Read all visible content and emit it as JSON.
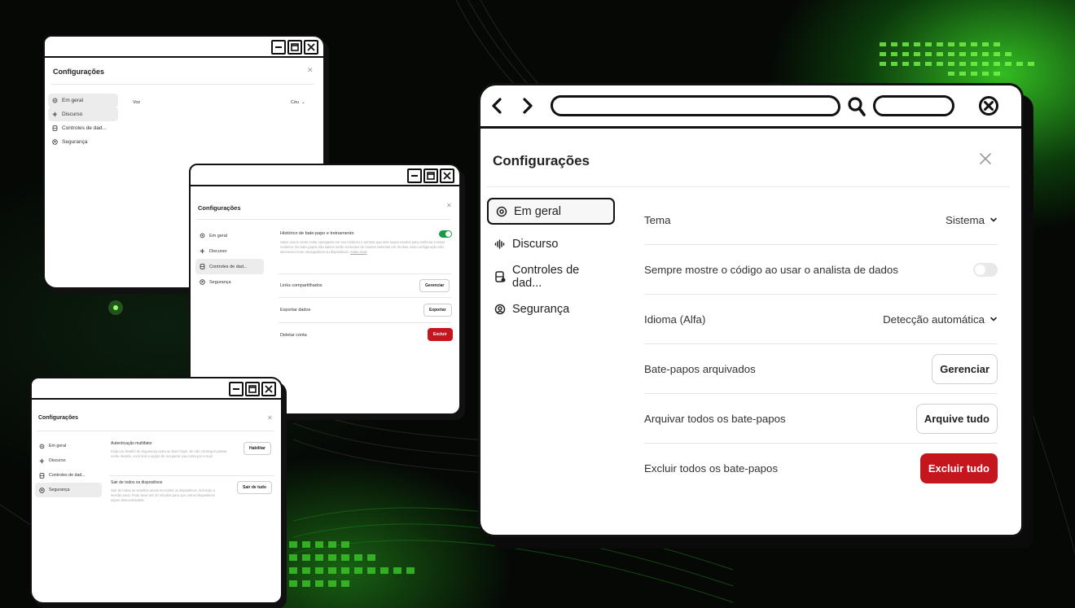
{
  "colors": {
    "accent_green": "#3cdc28",
    "danger_red": "#c4161c",
    "toggle_on": "#1a9b4b"
  },
  "window_general": {
    "title": "Configurações",
    "nav": [
      {
        "label": "Em geral",
        "icon": "gear-icon"
      },
      {
        "label": "Discurso",
        "icon": "waveform-icon"
      },
      {
        "label": "Controles de dad...",
        "icon": "database-icon"
      },
      {
        "label": "Segurança",
        "icon": "shield-icon"
      }
    ],
    "voice_label": "Voz",
    "voice_value": "Céu"
  },
  "window_data": {
    "title": "Configurações",
    "nav": [
      {
        "label": "Em geral",
        "icon": "gear-icon"
      },
      {
        "label": "Discurso",
        "icon": "waveform-icon"
      },
      {
        "label": "Controles de dad...",
        "icon": "database-icon"
      },
      {
        "label": "Segurança",
        "icon": "shield-icon"
      }
    ],
    "history_title": "Histórico de bate-papo e treinamento",
    "history_desc": "Salve novos chats neste navegador em seu histórico e permita que eles sejam usados para melhorar nossos modelos. Os bate-papos não salvos serão excluídos de nossos sistemas em 30 dias. Esta configuração não sincroniza entre navegadores ou dispositivos.",
    "history_link": "Saiba mais",
    "rows": [
      {
        "label": "Links compartilhados",
        "button": "Gerenciar"
      },
      {
        "label": "Exportar dados",
        "button": "Exportar"
      },
      {
        "label": "Deletar conta",
        "button": "Excluir"
      }
    ]
  },
  "window_security": {
    "title": "Configurações",
    "nav": [
      {
        "label": "Em geral",
        "icon": "gear-icon"
      },
      {
        "label": "Discurso",
        "icon": "waveform-icon"
      },
      {
        "label": "Controles de dad...",
        "icon": "database-icon"
      },
      {
        "label": "Segurança",
        "icon": "shield-icon"
      }
    ],
    "mfa_title": "Autenticação multifator",
    "mfa_desc": "Exija um desafio de segurança extra ao fazer login. Se não conseguir passar neste desafio, você terá a opção de recuperar sua conta por e-mail.",
    "mfa_button": "Habilitar",
    "logout_title": "Sair de todos os dispositivos",
    "logout_desc": "Sair de todas as sessões ativas em todos os dispositivos, incluindo a sessão atual. Pode levar até 30 minutos para que outros dispositivos sejam desconectados.",
    "logout_button": "Sair de tudo"
  },
  "main": {
    "title": "Configurações",
    "nav": [
      {
        "label": "Em geral",
        "icon": "gear-icon"
      },
      {
        "label": "Discurso",
        "icon": "waveform-icon"
      },
      {
        "label": "Controles de dad...",
        "icon": "database-icon"
      },
      {
        "label": "Segurança",
        "icon": "shield-icon"
      }
    ],
    "rows": {
      "theme_label": "Tema",
      "theme_value": "Sistema",
      "code_label": "Sempre mostre o código ao usar o analista de dados",
      "language_label": "Idioma (Alfa)",
      "language_value": "Detecção automática",
      "archived_label": "Bate-papos arquivados",
      "archived_button": "Gerenciar",
      "archive_all_label": "Arquivar todos os bate-papos",
      "archive_all_button": "Arquive tudo",
      "delete_all_label": "Excluir todos os bate-papos",
      "delete_all_button": "Excluir tudo"
    }
  }
}
